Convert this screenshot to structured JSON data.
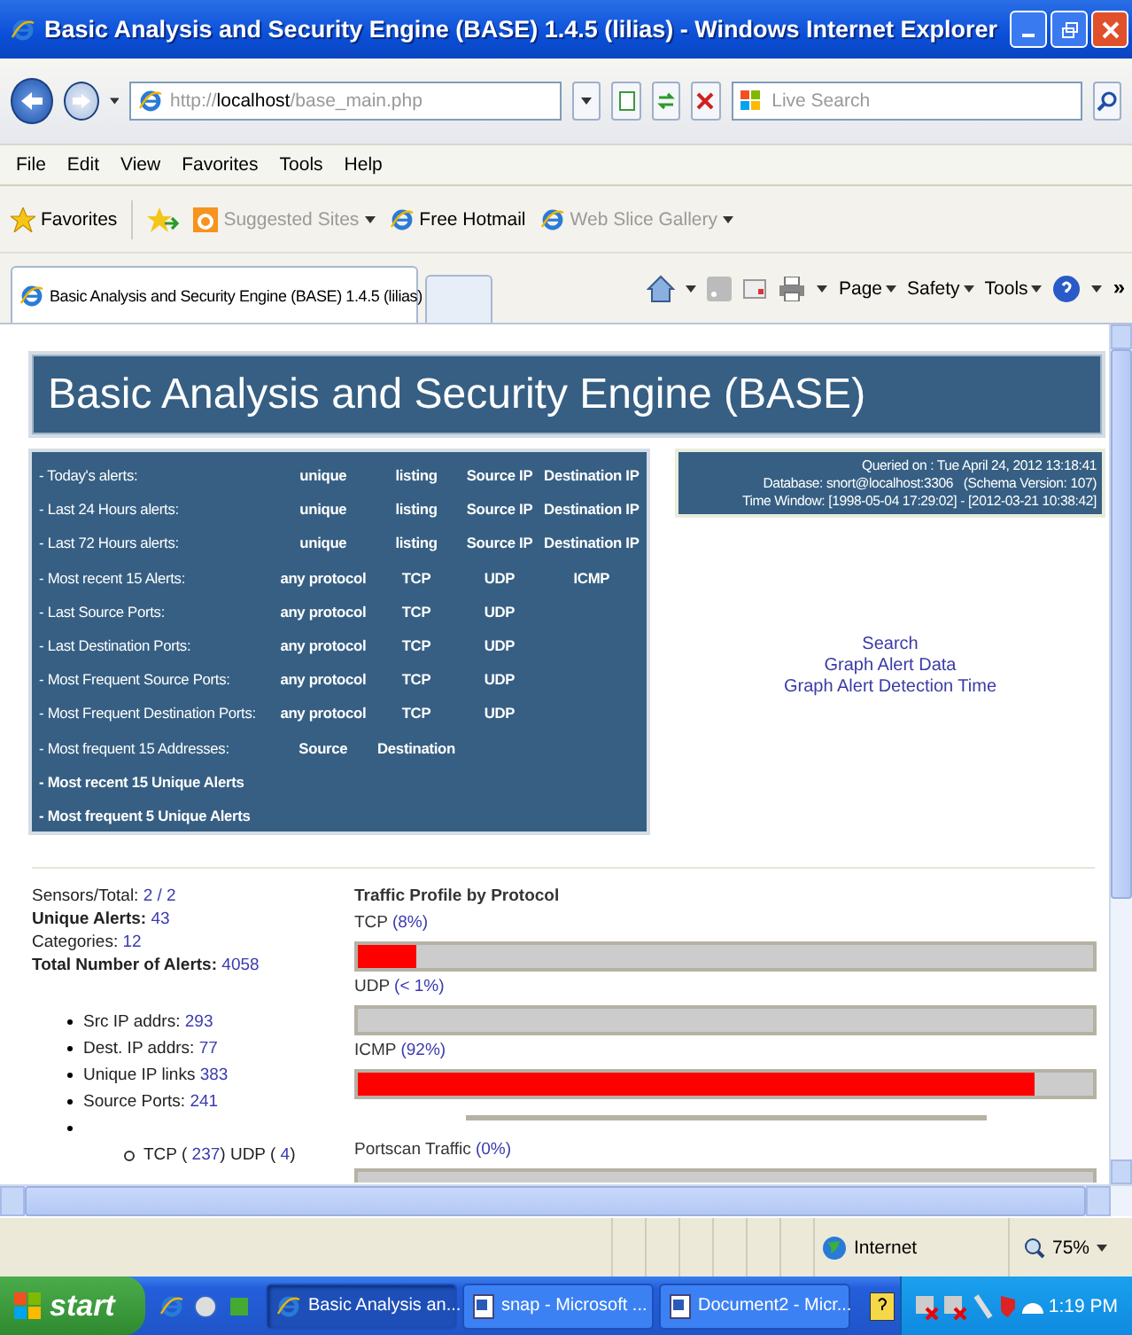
{
  "window": {
    "title": "Basic Analysis and Security Engine (BASE) 1.4.5 (lilias) - Windows Internet Explorer"
  },
  "address": {
    "scheme": "http://",
    "host": "localhost",
    "path": "/base_main.php"
  },
  "search": {
    "placeholder": "Live Search"
  },
  "menu": [
    "File",
    "Edit",
    "View",
    "Favorites",
    "Tools",
    "Help"
  ],
  "favorites_bar": {
    "label": "Favorites",
    "items": [
      {
        "label": "Suggested Sites",
        "dimmed": true,
        "dropdown": true
      },
      {
        "label": "Free Hotmail",
        "dimmed": false,
        "dropdown": false
      },
      {
        "label": "Web Slice Gallery",
        "dimmed": true,
        "dropdown": true
      }
    ]
  },
  "tabs": [
    {
      "label": "Basic Analysis and Security Engine (BASE) 1.4.5 (lilias)",
      "selected": true
    }
  ],
  "command_bar": {
    "menus": [
      "Page",
      "Safety",
      "Tools"
    ],
    "more": "»"
  },
  "page": {
    "banner": "Basic Analysis and Security Engine (BASE)",
    "alert_rows": [
      {
        "label": "- Today's alerts:",
        "links": [
          "unique",
          "listing",
          "Source IP",
          "Destination IP"
        ]
      },
      {
        "label": "- Last 24 Hours alerts:",
        "links": [
          "unique",
          "listing",
          "Source IP",
          "Destination IP"
        ]
      },
      {
        "label": "- Last 72 Hours alerts:",
        "links": [
          "unique",
          "listing",
          "Source IP",
          "Destination IP"
        ]
      },
      {
        "label": "- Most recent 15 Alerts:",
        "links": [
          "any protocol",
          "TCP",
          "UDP",
          "ICMP"
        ]
      },
      {
        "label": "- Last Source Ports:",
        "links": [
          "any protocol",
          "TCP",
          "UDP"
        ]
      },
      {
        "label": "- Last Destination Ports:",
        "links": [
          "any protocol",
          "TCP",
          "UDP"
        ]
      },
      {
        "label": "- Most Frequent Source Ports:",
        "links": [
          "any protocol",
          "TCP",
          "UDP"
        ]
      },
      {
        "label": "- Most Frequent Destination Ports:",
        "links": [
          "any protocol",
          "TCP",
          "UDP"
        ]
      },
      {
        "label": "- Most frequent 15 Addresses:",
        "links": [
          "Source",
          "Destination"
        ]
      },
      {
        "label": "- Most recent 15 Unique Alerts",
        "links": []
      },
      {
        "label": "- Most frequent 5 Unique Alerts",
        "links": []
      }
    ],
    "info": [
      "Queried on : Tue April 24, 2012 13:18:41",
      "Database: snort@localhost:3306   (Schema Version: 107)",
      "Time Window: [1998-05-04 17:29:02] - [2012-03-21 10:38:42]"
    ],
    "actions": [
      "Search",
      "Graph Alert Data",
      "Graph Alert Detection Time"
    ],
    "stats": [
      {
        "label": "Sensors/Total:",
        "value": "2 / 2"
      },
      {
        "label": "Unique Alerts:",
        "value": "43"
      },
      {
        "label": "Categories:",
        "value": "12"
      },
      {
        "label": "Total Number of Alerts:",
        "value": "4058"
      }
    ],
    "ip_stats": [
      {
        "label": "Src IP addrs:",
        "value": "293"
      },
      {
        "label": "Dest. IP addrs:",
        "value": "77"
      },
      {
        "label": "Unique IP links",
        "value": "383"
      },
      {
        "label": "Source Ports:",
        "value": "241"
      },
      {
        "children": [
          {
            "label": "TCP (",
            "value": "237",
            "end": ")"
          },
          {
            "label": "UDP (",
            "value": "4",
            "end": ")"
          }
        ]
      }
    ],
    "traffic": {
      "title": "Traffic Profile by Protocol",
      "bars": [
        {
          "name": "TCP",
          "share": "(8%)",
          "level": 0.08
        },
        {
          "name": "UDP",
          "share": "(< 1%)",
          "level": 0.0
        },
        {
          "name": "ICMP",
          "share": "(92%)",
          "level": 0.92
        }
      ]
    },
    "portscan": {
      "name": "Portscan Traffic",
      "share": "(0%)"
    }
  },
  "status_bar": {
    "zone": "Internet",
    "zoom": "75%"
  },
  "taskbar": {
    "start": "start",
    "tasks": [
      {
        "label": "Basic Analysis an...",
        "kind": "ie",
        "selected": true
      },
      {
        "label": "snap - Microsoft ...",
        "kind": "word",
        "selected": false
      },
      {
        "label": "Document2 - Micr...",
        "kind": "word",
        "selected": false
      }
    ],
    "clock": "1:19 PM"
  }
}
